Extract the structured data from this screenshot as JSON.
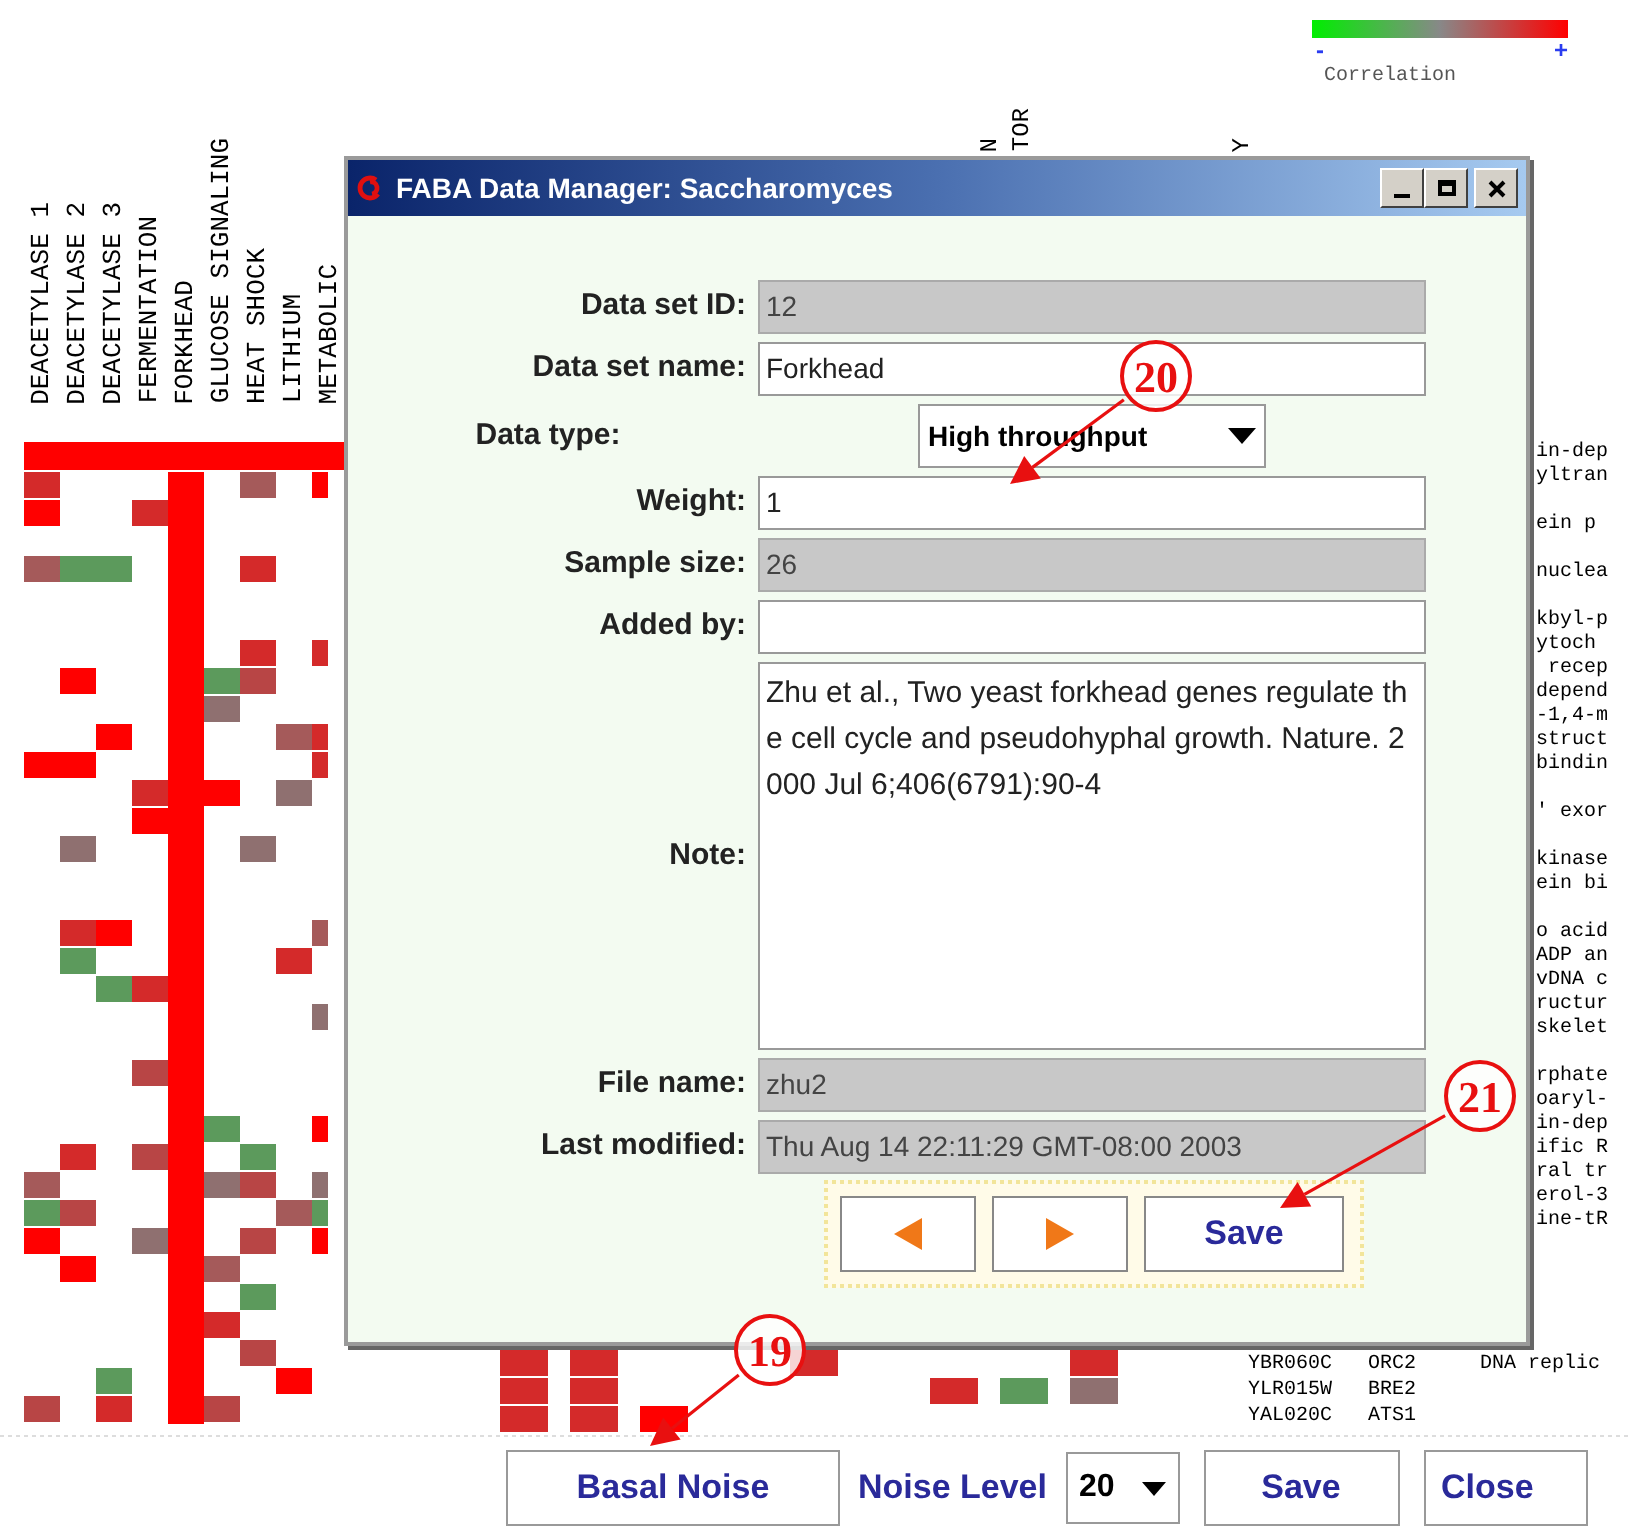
{
  "column_headers": [
    "DEACETYLASE 1",
    "DEACETYLASE 2",
    "DEACETYLASE 3",
    "FERMENTATION",
    "FORKHEAD",
    "GLUCOSE SIGNALING",
    "HEAT SHOCK",
    "LITHIUM",
    "METABOLIC"
  ],
  "column_headers_right": [
    "N",
    "TOR",
    "Y"
  ],
  "legend": {
    "min": "-",
    "max": "+",
    "label": "Correlation"
  },
  "gene_descriptions": [
    [
      "in-dep",
      "yltran"
    ],
    [
      "ein p"
    ],
    [
      "nuclea"
    ],
    [
      "kbyl-p",
      "ytoch",
      " recep",
      "depend",
      "-1,4-m",
      "struct",
      "bindin"
    ],
    [
      "' exor"
    ],
    [
      "kinase",
      "ein bi"
    ],
    [
      "o acid",
      "ADP an",
      "vDNA c",
      "ructur",
      "skelet"
    ],
    [
      "rphate",
      "oaryl-",
      "in-dep",
      "ific R",
      "ral tr",
      "erol-3",
      "ine-tR"
    ]
  ],
  "gene_rows": [
    {
      "id": "YBR060C",
      "name": "ORC2",
      "description": "DNA replic"
    },
    {
      "id": "YLR015W",
      "name": "BRE2"
    },
    {
      "id": "YAL020C",
      "name": "ATS1"
    }
  ],
  "dialog": {
    "title": "FABA Data Manager: Saccharomyces",
    "fields": [
      {
        "label": "Data set ID:",
        "value": "12",
        "kind": "readonly"
      },
      {
        "label": "Data set name:",
        "value": "Forkhead",
        "kind": "text"
      },
      {
        "label": "Data type:",
        "value": "High throughput",
        "kind": "dropdown"
      },
      {
        "label": "Weight:",
        "value": "1",
        "kind": "text"
      },
      {
        "label": "Sample size:",
        "value": "26",
        "kind": "readonly"
      },
      {
        "label": "Added by:",
        "kind": "text"
      },
      {
        "label": "Note:",
        "value": "Zhu et al., Two yeast forkhead genes regulate the cell cycle and pseudohyphal growth. Nature. 2000 Jul 6;406(6791):90-4",
        "kind": "textarea"
      },
      {
        "label": "File name:",
        "value": "zhu2",
        "kind": "readonly"
      },
      {
        "label": "Last modified:",
        "value": "Thu Aug 14 22:11:29 GMT-08:00 2003",
        "kind": "readonly"
      }
    ],
    "save_button": "Save"
  },
  "toolbar": {
    "basal_noise_button": "Basal Noise",
    "noise_level_label": "Noise Level",
    "noise_level": "20",
    "save_button": "Save",
    "close_button": "Close"
  },
  "callouts": [
    {
      "number": "20"
    },
    {
      "number": "21"
    },
    {
      "number": "19"
    }
  ]
}
